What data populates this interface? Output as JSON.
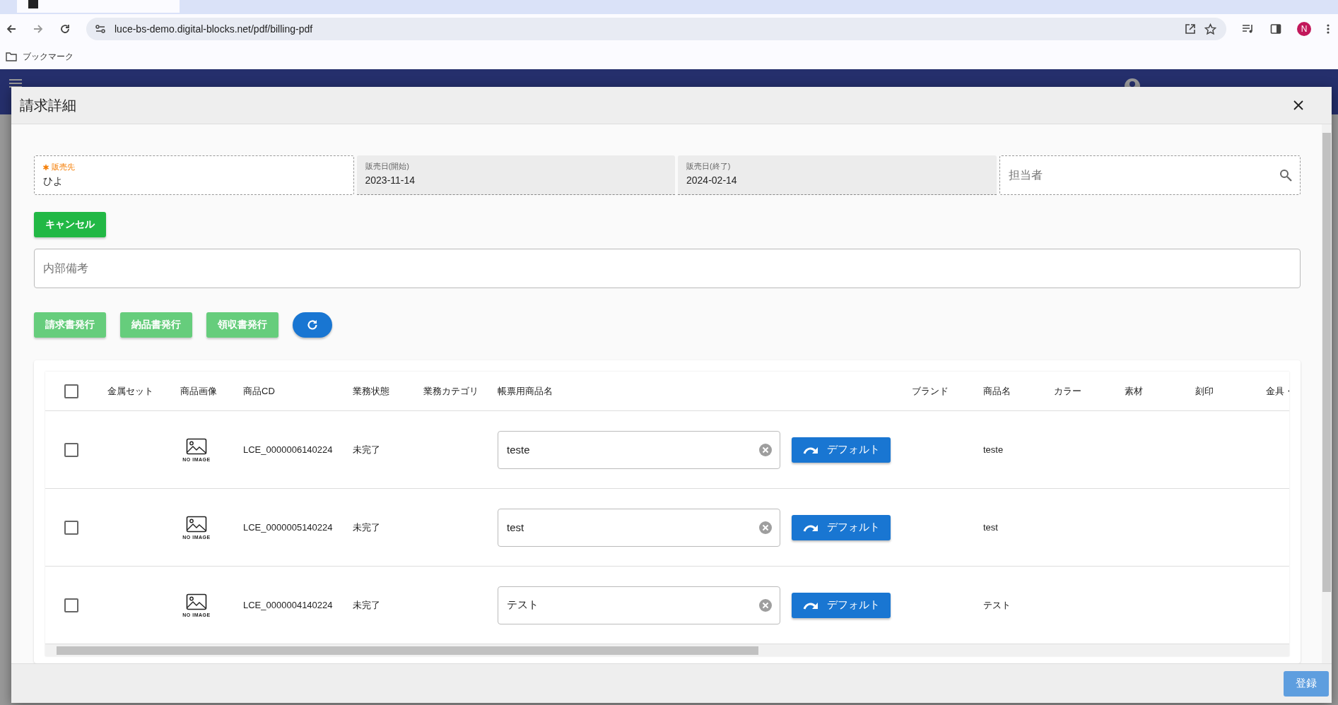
{
  "browser": {
    "url": "luce-bs-demo.digital-blocks.net/pdf/billing-pdf",
    "bookmarks_label": "ブックマーク",
    "profile_initial": "N"
  },
  "dialog": {
    "title": "請求詳細",
    "fields": [
      {
        "kind": "select",
        "label": "販売先",
        "required": true,
        "value": "ひよ"
      },
      {
        "kind": "readonly",
        "label": "販売日(開始)",
        "required": false,
        "value": "2023-11-14"
      },
      {
        "kind": "readonly",
        "label": "販売日(終了)",
        "required": false,
        "value": "2024-02-14"
      },
      {
        "kind": "search",
        "placeholder": "担当者"
      }
    ],
    "cancel_button": "キャンセル",
    "memo": {
      "placeholder": "内部備考"
    },
    "actions": [
      {
        "label": "請求書発行",
        "disabled": true
      },
      {
        "label": "納品書発行",
        "disabled": true
      },
      {
        "label": "領収書発行",
        "disabled": true
      }
    ],
    "table": {
      "select_all_checked": false,
      "columns": [
        "金属セット",
        "商品画像",
        "商品CD",
        "業務状態",
        "業務カテゴリ",
        "帳票用商品名",
        "ブランド",
        "商品名",
        "カラー",
        "素材",
        "刻印",
        "金具・"
      ],
      "rows": [
        {
          "checked": false,
          "image_label": "NO IMAGE",
          "product_cd": "LCE_0000006140224",
          "status": "未完了",
          "print_name": "teste",
          "default_button": "デフォルト",
          "product_name": "teste"
        },
        {
          "checked": false,
          "image_label": "NO IMAGE",
          "product_cd": "LCE_0000005140224",
          "status": "未完了",
          "print_name": "test",
          "default_button": "デフォルト",
          "product_name": "test"
        },
        {
          "checked": false,
          "image_label": "NO IMAGE",
          "product_cd": "LCE_0000004140224",
          "status": "未完了",
          "print_name": "テスト",
          "default_button": "デフォルト",
          "product_name": "テスト"
        }
      ]
    },
    "submit_button": {
      "label": "登録",
      "disabled": true
    }
  }
}
